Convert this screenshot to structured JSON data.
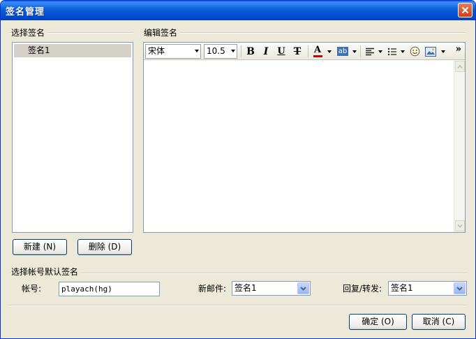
{
  "window": {
    "title": "签名管理"
  },
  "left_group": {
    "label": "选择签名",
    "items": [
      "签名1"
    ],
    "new_button": "新建 (N)",
    "delete_button": "删除 (D)"
  },
  "editor_group": {
    "label": "编辑签名",
    "font_name": "宋体",
    "font_size": "10.5",
    "bold": "B",
    "italic": "I",
    "underline": "U",
    "strike": "T",
    "font_color": "A",
    "highlight": "ab",
    "more": "»"
  },
  "defaults_group": {
    "label": "选择帐号默认签名",
    "account_label": "帐号:",
    "account_value": "playach(hg)",
    "new_mail_label": "新邮件:",
    "new_mail_value": "签名1",
    "reply_label": "回复/转发:",
    "reply_value": "签名1"
  },
  "footer": {
    "ok_button": "确定 (O)",
    "cancel_button": "取消 (C)"
  },
  "colors": {
    "title_bar": "#0a5fd8",
    "dialog_bg": "#ece9d8",
    "input_border": "#7f9db9",
    "font_color_bar": "#cc0000",
    "highlight_bg": "#3c6fb6"
  }
}
